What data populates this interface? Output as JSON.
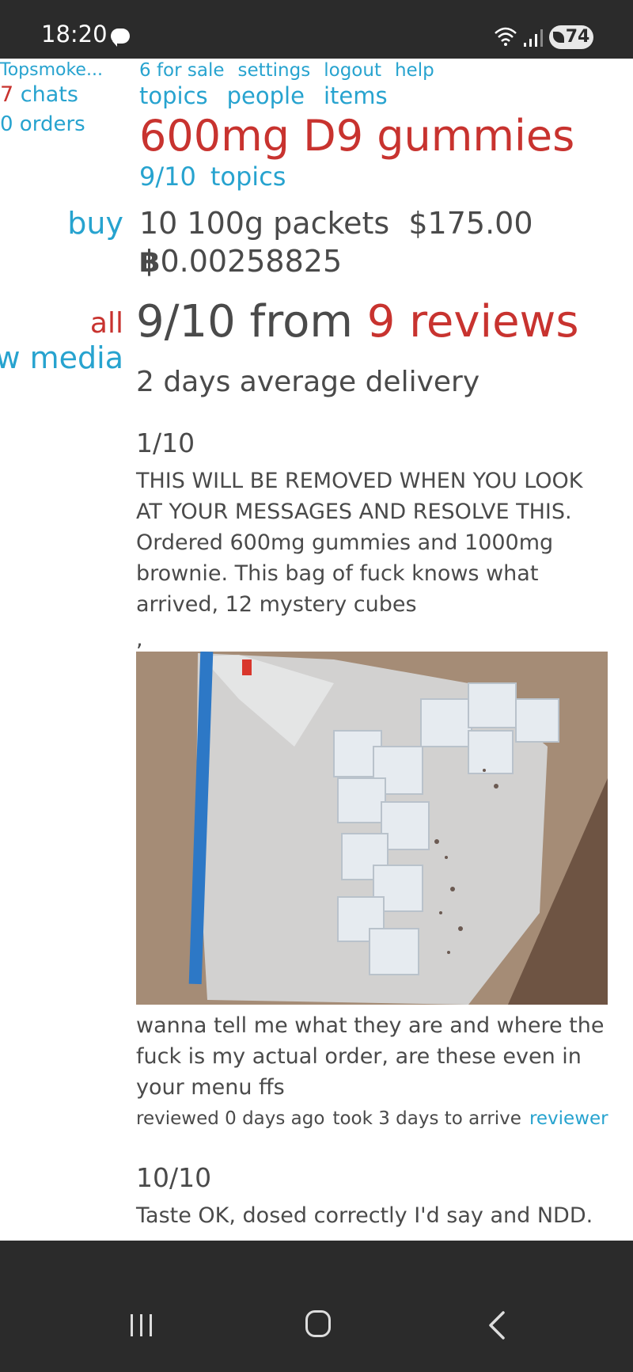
{
  "status": {
    "time": "18:20",
    "battery": "74"
  },
  "left": {
    "site": "Topsmoke...",
    "chats_count": "7",
    "chats_label": " chats",
    "orders": "0 orders"
  },
  "nav_top": [
    "6 for sale",
    "settings",
    "logout",
    "help"
  ],
  "nav_main": [
    "topics",
    "people",
    "items"
  ],
  "listing": {
    "title": "600mg D9 gummies",
    "rating_short": "9/10",
    "topics_link": "topics",
    "buy_label": "buy",
    "quantity": "10 100g packets",
    "price_usd": "$175.00",
    "btc_symbol": "฿",
    "price_btc": "0.00258825",
    "rating_prefix": "9/10 from ",
    "reviews_link": "9 reviews",
    "delivery": "2 days average delivery"
  },
  "filters": {
    "all": "all",
    "with_media": "w media"
  },
  "reviews": [
    {
      "score": "1/10",
      "text": "THIS WILL BE REMOVED WHEN YOU LOOK AT YOUR MESSAGES AND RESOLVE THIS. Ordered 600mg gummies and 1000mg brownie. This bag of fuck knows what arrived, 12 mystery cubes",
      "separator": ",",
      "text_after": " wanna tell me what they are and where the fuck is my actual order, are these even in your menu ffs",
      "reviewed": "reviewed 0 days ago",
      "took": "took 3 days to arrive",
      "reviewer_link": "reviewer"
    },
    {
      "score": "10/10",
      "text": "Taste OK, dosed correctly I'd say and NDD."
    }
  ],
  "colors": {
    "link": "#27a3cf",
    "accent_red": "#c8332f",
    "text": "#4a4a4a",
    "chrome": "#2b2b2b"
  },
  "icons": [
    "chat-bubble-icon",
    "wifi-icon",
    "signal-icon",
    "battery-icon",
    "recent-apps-icon",
    "home-icon",
    "back-icon"
  ]
}
